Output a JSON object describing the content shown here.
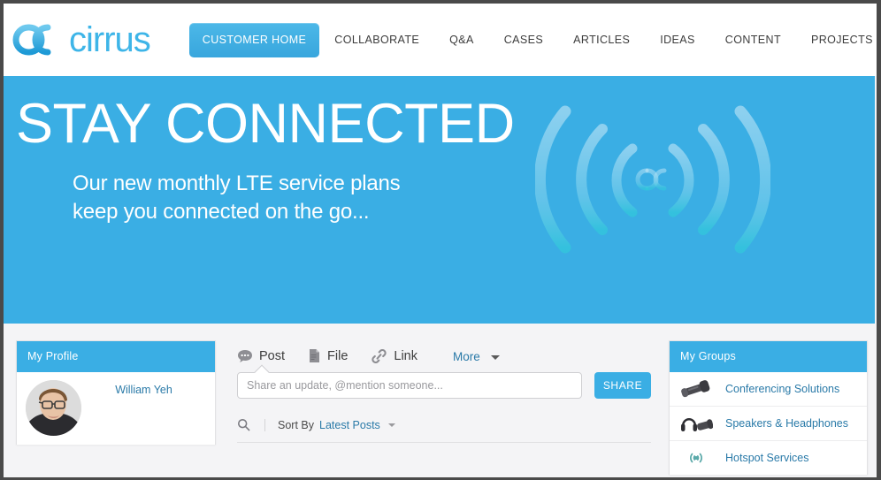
{
  "brand": {
    "name": "cirrus",
    "logo_icon": "cirrus-infinity-rings-icon",
    "accent_color": "#3aaee4",
    "link_color": "#2a7aa8"
  },
  "nav": {
    "items": [
      {
        "label": "CUSTOMER HOME",
        "active": true
      },
      {
        "label": "COLLABORATE",
        "active": false
      },
      {
        "label": "Q&A",
        "active": false
      },
      {
        "label": "CASES",
        "active": false
      },
      {
        "label": "ARTICLES",
        "active": false
      },
      {
        "label": "IDEAS",
        "active": false
      },
      {
        "label": "CONTENT",
        "active": false
      },
      {
        "label": "PROJECTS",
        "active": false
      }
    ]
  },
  "hero": {
    "title": "STAY CONNECTED",
    "subtitle_line1": "Our new monthly LTE service plans",
    "subtitle_line2": "keep you connected on the go...",
    "background_color": "#3aaee4",
    "art_icon": "wireless-signal-waves-icon"
  },
  "profile_panel": {
    "title": "My Profile",
    "avatar_icon": "user-photo-avatar",
    "user_name": "William Yeh"
  },
  "composer": {
    "tabs": [
      {
        "label": "Post",
        "icon": "speech-bubble-icon",
        "active": true
      },
      {
        "label": "File",
        "icon": "document-file-icon",
        "active": false
      },
      {
        "label": "Link",
        "icon": "chain-link-icon",
        "active": false
      }
    ],
    "more_label": "More",
    "more_icon": "chevron-down-icon",
    "input_placeholder": "Share an update, @mention someone...",
    "input_value": "",
    "share_label": "SHARE"
  },
  "feed_controls": {
    "search_icon": "search-icon",
    "sort_label": "Sort By",
    "sort_value": "Latest Posts",
    "sort_caret_icon": "chevron-down-icon"
  },
  "groups_panel": {
    "title": "My Groups",
    "items": [
      {
        "label": "Conferencing Solutions",
        "icon": "conference-phone-icon"
      },
      {
        "label": "Speakers & Headphones",
        "icon": "headphones-speaker-icon"
      },
      {
        "label": "Hotspot Services",
        "icon": "wifi-hotspot-icon"
      }
    ]
  }
}
